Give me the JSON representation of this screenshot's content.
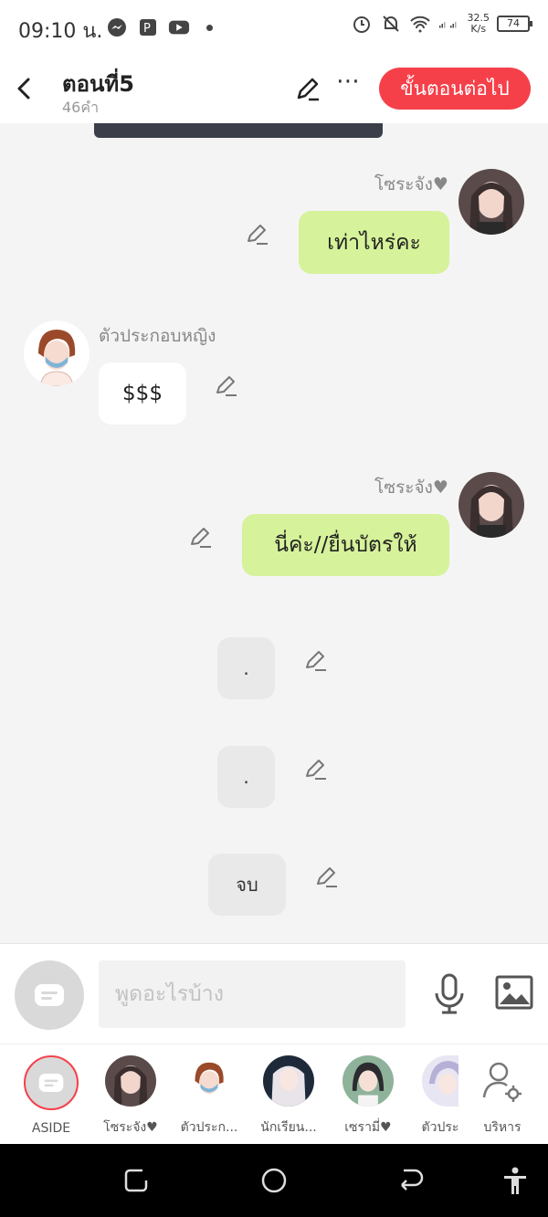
{
  "status": {
    "time": "09:10 น.",
    "speed_top": "32.5",
    "speed_bottom": "K/s",
    "battery": "74"
  },
  "header": {
    "title": "ตอนที่5",
    "subtitle": "46คำ",
    "next_label": "ขั้นตอนต่อไป"
  },
  "messages": [
    {
      "sender": "โซระจัง♥",
      "text": "เท่าไหร่คะ",
      "side": "right",
      "style": "green"
    },
    {
      "sender": "ตัวประกอบหญิง",
      "text": "$$$",
      "side": "left",
      "style": "white"
    },
    {
      "sender": "โซระจัง♥",
      "text": "นี่ค่ะ//ยื่นบัตรให้",
      "side": "right",
      "style": "green"
    },
    {
      "sender": "",
      "text": ".",
      "side": "center",
      "style": "gray"
    },
    {
      "sender": "",
      "text": ".",
      "side": "center",
      "style": "gray"
    },
    {
      "sender": "",
      "text": "จบ",
      "side": "center",
      "style": "gray"
    }
  ],
  "input": {
    "placeholder": "พูดอะไรบ้าง"
  },
  "characters": [
    {
      "label": "ASIDE"
    },
    {
      "label": "โซระจัง♥"
    },
    {
      "label": "ตัวประก..."
    },
    {
      "label": "นักเรียน..."
    },
    {
      "label": "เซรามี่♥"
    },
    {
      "label": "ตัวประ"
    },
    {
      "label": "บริหาร"
    }
  ],
  "colors": {
    "accent": "#f5404a",
    "green_bubble": "#d6f29a",
    "chat_bg": "#f4f4f4"
  }
}
